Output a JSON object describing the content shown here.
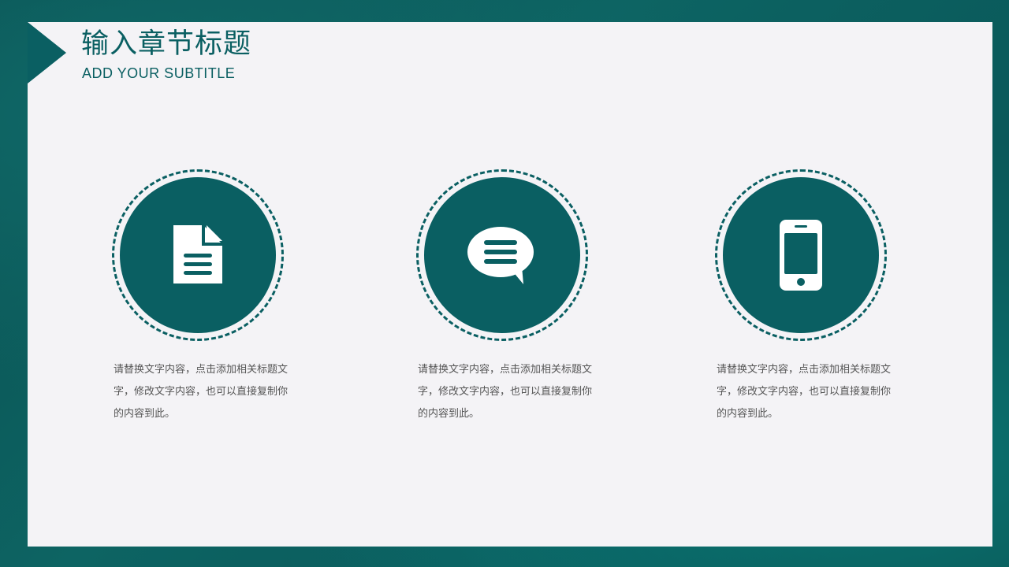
{
  "slide": {
    "title": "输入章节标题",
    "subtitle": "ADD YOUR SUBTITLE"
  },
  "features": [
    {
      "icon": "document-icon",
      "text": "请替换文字内容，点击添加相关标题文字，修改文字内容，也可以直接复制你的内容到此。"
    },
    {
      "icon": "chat-bubble-icon",
      "text": "请替换文字内容，点击添加相关标题文字，修改文字内容，也可以直接复制你的内容到此。"
    },
    {
      "icon": "smartphone-icon",
      "text": "请替换文字内容，点击添加相关标题文字，修改文字内容，也可以直接复制你的内容到此。"
    }
  ],
  "colors": {
    "accent": "#0a5f62",
    "panel": "#f4f3f6",
    "body_text": "#555555"
  }
}
